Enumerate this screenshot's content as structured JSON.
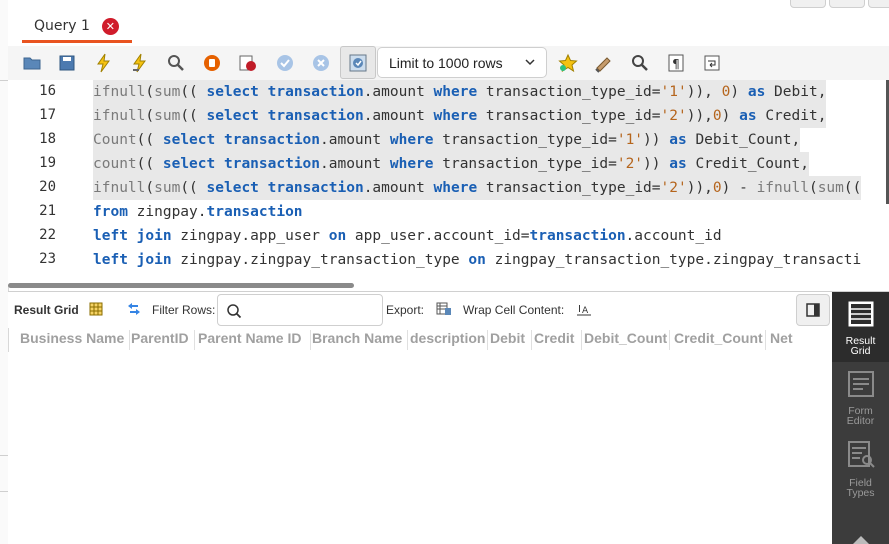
{
  "tab": {
    "label": "Query 1",
    "close_glyph": "✕"
  },
  "toolbar": {
    "icons": [
      "open-file-icon",
      "save-icon",
      "execute-icon",
      "execute-current-icon",
      "explain-icon",
      "stop-icon",
      "toggle-error-icon",
      "commit-icon",
      "rollback-icon",
      "autocommit-icon",
      "bookmark-star-icon",
      "beautify-icon",
      "find-icon",
      "invisible-chars-icon",
      "wrap-icon"
    ],
    "limit_select": {
      "value": "Limit to 1000 rows"
    }
  },
  "editor": {
    "lines": [
      {
        "num": "16",
        "text": "ifnull(sum(( select transaction.amount where transaction_type_id='1')), 0) as Debit,"
      },
      {
        "num": "17",
        "text": "ifnull(sum(( select transaction.amount where transaction_type_id='2')),0) as Credit,"
      },
      {
        "num": "18",
        "text": "Count(( select transaction.amount where transaction_type_id='1')) as Debit_Count,"
      },
      {
        "num": "19",
        "text": "count(( select transaction.amount where transaction_type_id='2')) as Credit_Count,"
      },
      {
        "num": "20",
        "text": "ifnull(sum(( select transaction.amount where transaction_type_id='2')),0) - ifnull(sum(("
      },
      {
        "num": "21",
        "text": "from zingpay.transaction"
      },
      {
        "num": "22",
        "text": "left join zingpay.app_user on app_user.account_id=transaction.account_id"
      },
      {
        "num": "23",
        "text": "left join zingpay.zingpay_transaction_type on zingpay_transaction_type.zingpay_transacti"
      }
    ]
  },
  "result_toolbar": {
    "result_grid_label": "Result Grid",
    "filter_rows_label": "Filter Rows:",
    "filter_value": "",
    "export_label": "Export:",
    "wrap_label": "Wrap Cell Content:"
  },
  "grid": {
    "columns": [
      "Business Name",
      "ParentID",
      "Parent Name ID",
      "Branch Name",
      "description",
      "Debit",
      "Credit",
      "Debit_Count",
      "Credit_Count",
      "Net"
    ]
  },
  "sidebar": {
    "items": [
      {
        "label_line1": "Result",
        "label_line2": "Grid",
        "active": true
      },
      {
        "label_line1": "Form",
        "label_line2": "Editor",
        "active": false
      },
      {
        "label_line1": "Field",
        "label_line2": "Types",
        "active": false
      }
    ]
  },
  "colors": {
    "accent": "#e95420",
    "keyword": "#1a5fb4",
    "string": "#b5651d",
    "close_red": "#d01c2b",
    "sidebar_bg": "#3c3c3c"
  }
}
